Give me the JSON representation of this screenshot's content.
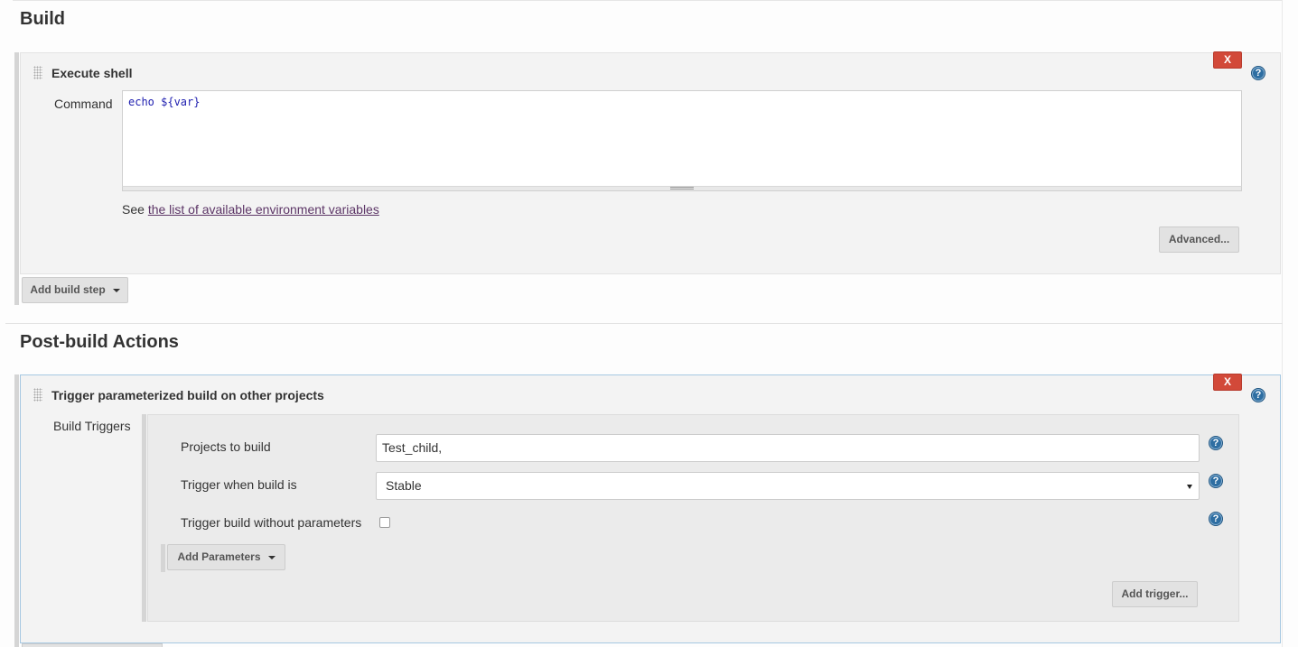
{
  "build": {
    "title": "Build",
    "step": {
      "title": "Execute shell",
      "delete_label": "X",
      "help_label": "?",
      "command_label": "Command",
      "command_value": "echo ${var}",
      "see_prefix": "See",
      "env_link": "the list of available environment variables",
      "advanced_label": "Advanced..."
    },
    "add_step_label": "Add build step"
  },
  "post_build": {
    "title": "Post-build Actions",
    "action": {
      "title": "Trigger parameterized build on other projects",
      "delete_label": "X",
      "help_label": "?",
      "build_triggers_label": "Build Triggers",
      "projects_label": "Projects to build",
      "projects_value": "Test_child,",
      "trigger_when_label": "Trigger when build is",
      "trigger_when_value": "Stable",
      "no_params_label": "Trigger build without parameters",
      "no_params_checked": false,
      "add_parameters_label": "Add Parameters",
      "add_trigger_label": "Add trigger..."
    }
  },
  "colors": {
    "delete": "#d24939",
    "help": "#2e6ea2",
    "link": "#5c3566",
    "command_text": "#2020b0"
  }
}
